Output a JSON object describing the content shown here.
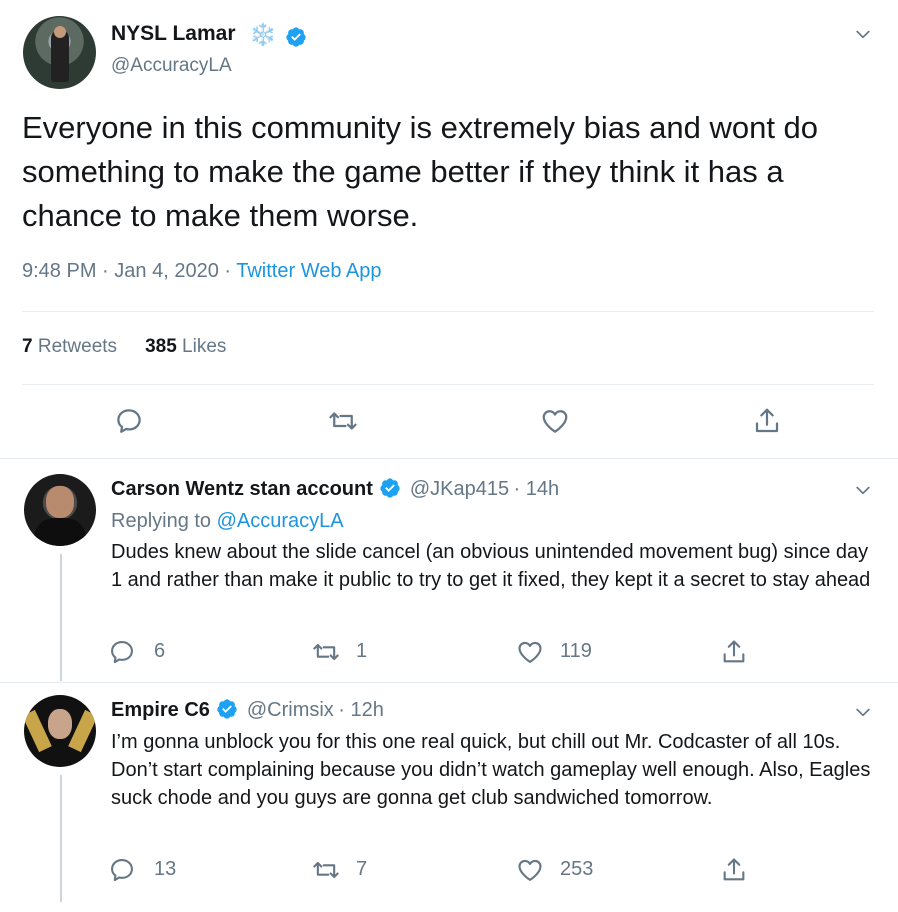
{
  "main_tweet": {
    "display_name": "NYSL Lamar",
    "name_emoji": "❄️",
    "handle": "@AccuracyLA",
    "text": "Everyone in this community is extremely bias and wont do something to make the game better if they think it has a chance to make them worse.",
    "time": "9:48 PM",
    "date": "Jan 4, 2020",
    "source": "Twitter Web App",
    "sep": "·",
    "retweets_count": "7",
    "retweets_label": "Retweets",
    "likes_count": "385",
    "likes_label": "Likes"
  },
  "replies": [
    {
      "display_name": "Carson Wentz stan account",
      "handle": "@JKap415",
      "age": "· 14h",
      "replying_prefix": "Replying to",
      "replying_to": "@AccuracyLA",
      "text": "Dudes knew about the slide cancel (an obvious unintended movement bug) since day 1 and rather than make it public to try to get it fixed, they kept it a secret to stay ahead",
      "reply_count": "6",
      "retweet_count": "1",
      "like_count": "119"
    },
    {
      "display_name": "Empire C6",
      "handle": "@Crimsix",
      "age": "· 12h",
      "text": "I’m gonna unblock you for this one real quick, but chill out Mr. Codcaster of all 10s. Don’t start complaining because you didn’t watch gameplay well enough. Also, Eagles suck chode and you guys are gonna get club sandwiched tomorrow.",
      "reply_count": "13",
      "retweet_count": "7",
      "like_count": "253"
    }
  ],
  "colors": {
    "accent": "#1b95e0",
    "verified": "#1da1f2",
    "muted": "#657786",
    "text": "#14171a",
    "divider": "#e6ecf0"
  },
  "icons": [
    "verified-badge-icon",
    "chevron-down-icon",
    "reply-icon",
    "retweet-icon",
    "like-icon",
    "share-icon"
  ]
}
